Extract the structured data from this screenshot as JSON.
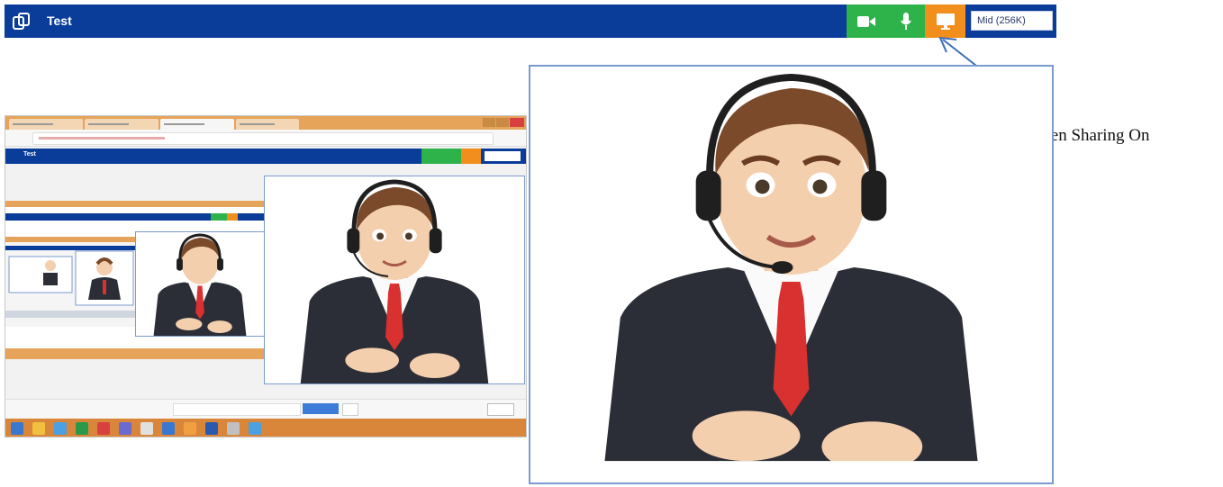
{
  "app": {
    "title": "Test"
  },
  "toolbar": {
    "camera_icon": "video-camera-icon",
    "mic_icon": "microphone-icon",
    "screen_icon": "monitor-icon",
    "quality_value": "Mid (256K)"
  },
  "annotation": {
    "text": "Screen Sharing On"
  },
  "colors": {
    "bar": "#0a3c9a",
    "green": "#2db34a",
    "orange": "#f28e1c",
    "video_border": "#7b9bd0"
  }
}
